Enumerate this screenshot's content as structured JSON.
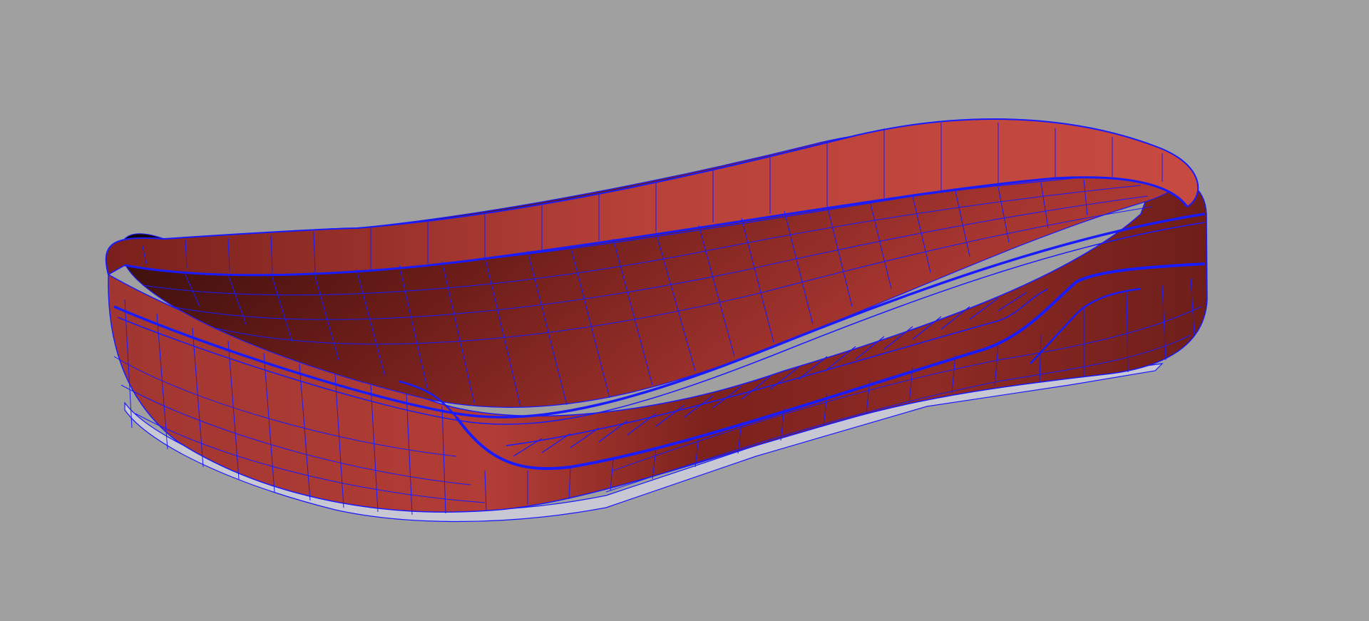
{
  "viewport": {
    "background": "#a0a0a0",
    "display_mode": "shaded-with-wireframe"
  },
  "model": {
    "object": "shoe-outsole",
    "surface_color": "#9a2e2a",
    "surface_highlight": "#c0433b",
    "surface_shadow": "#2a0a08",
    "wireframe_color": "#1a1aff",
    "tread_color": "#c8c8d4"
  }
}
